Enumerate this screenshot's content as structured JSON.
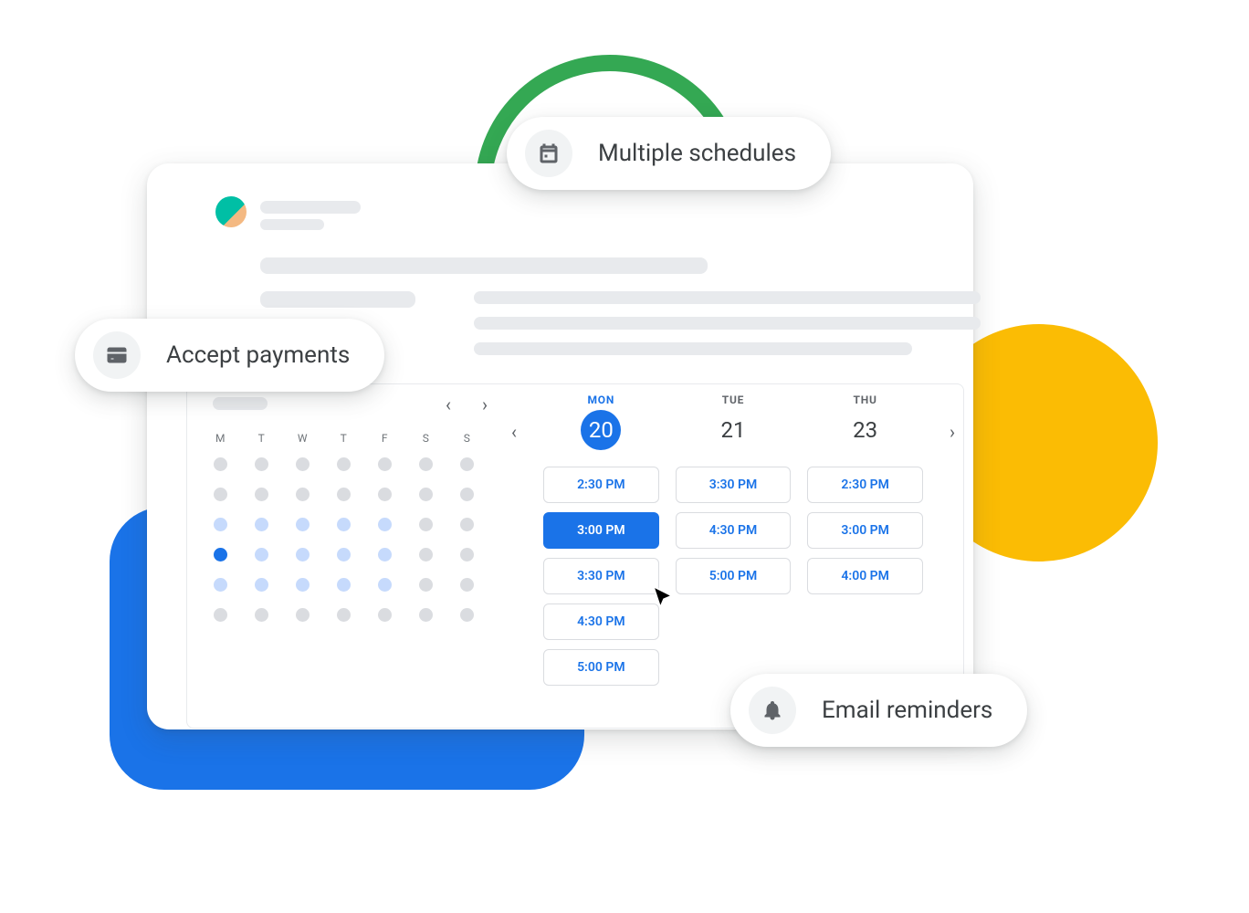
{
  "features": {
    "payments": "Accept payments",
    "schedules": "Multiple schedules",
    "reminders": "Email reminders"
  },
  "mini_calendar": {
    "dow": [
      "M",
      "T",
      "W",
      "T",
      "F",
      "S",
      "S"
    ],
    "weeks": [
      [
        "g",
        "g",
        "g",
        "g",
        "g",
        "g",
        "g"
      ],
      [
        "g",
        "g",
        "g",
        "g",
        "g",
        "g",
        "g"
      ],
      [
        "a",
        "a",
        "a",
        "a",
        "a",
        "g",
        "g"
      ],
      [
        "c",
        "a",
        "a",
        "a",
        "a",
        "g",
        "g"
      ],
      [
        "a",
        "a",
        "a",
        "a",
        "a",
        "g",
        "g"
      ],
      [
        "g",
        "g",
        "g",
        "g",
        "g",
        "g",
        "g"
      ]
    ]
  },
  "day_columns": [
    {
      "dow": "MON",
      "num": "20",
      "active": true,
      "slots": [
        "2:30 PM",
        "3:00 PM",
        "3:30 PM",
        "4:30 PM",
        "5:00 PM"
      ],
      "selected": "3:00 PM"
    },
    {
      "dow": "TUE",
      "num": "21",
      "active": false,
      "slots": [
        "3:30 PM",
        "4:30 PM",
        "5:00 PM"
      ],
      "selected": null
    },
    {
      "dow": "THU",
      "num": "23",
      "active": false,
      "slots": [
        "2:30 PM",
        "3:00 PM",
        "4:00 PM"
      ],
      "selected": null
    }
  ]
}
